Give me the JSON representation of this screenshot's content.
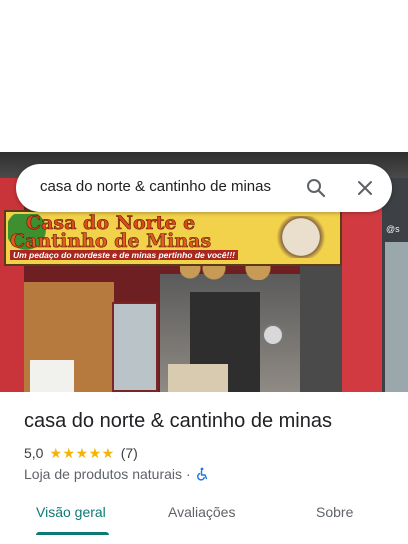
{
  "search": {
    "query": "casa do norte & cantinho de minas",
    "search_icon": "search-icon",
    "close_icon": "close-icon"
  },
  "photo": {
    "banner_line1": "Casa do Norte e",
    "banner_line2": "Cantinho de Minas",
    "banner_line3": "Um pedaço do nordeste e de minas pertinho de você!!!",
    "side_text": "@s"
  },
  "place": {
    "name": "casa do norte & cantinho de minas",
    "rating": "5,0",
    "stars": "★★★★★",
    "review_count": "(7)",
    "category": "Loja de produtos naturais",
    "separator": "·",
    "accessibility_icon": "wheelchair-icon"
  },
  "tabs": [
    {
      "label": "Visão geral",
      "selected": true
    },
    {
      "label": "Avaliações",
      "selected": false
    },
    {
      "label": "Sobre",
      "selected": false
    }
  ],
  "colors": {
    "accent": "#0b7a75",
    "star": "#f4b400"
  }
}
